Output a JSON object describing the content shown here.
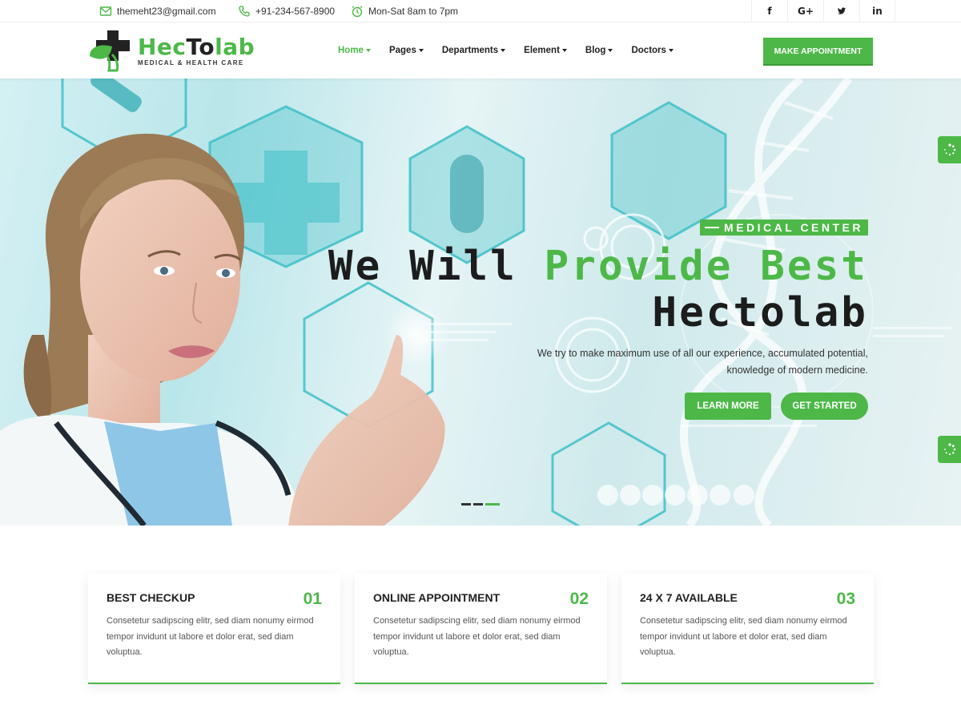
{
  "topbar": {
    "email": "themeht23@gmail.com",
    "phone": "+91-234-567-8900",
    "hours": "Mon-Sat 8am to 7pm",
    "social": [
      {
        "label": "f",
        "icon": "facebook-icon"
      },
      {
        "label": "G+",
        "icon": "google-plus-icon"
      },
      {
        "label": "𝕥",
        "icon": "twitter-icon"
      },
      {
        "label": "in",
        "icon": "linkedin-icon"
      }
    ]
  },
  "brand": {
    "name_green": "Hec",
    "name_dark": "To",
    "name_end": "lab",
    "tagline": "MEDICAL & HEALTH CARE"
  },
  "nav": {
    "items": [
      "Home",
      "Pages",
      "Departments",
      "Element",
      "Blog",
      "Doctors"
    ],
    "active": "Home",
    "cta": "MAKE APPOINTMENT"
  },
  "hero": {
    "tagline": "MEDICAL CENTER",
    "title_plain": "We Will ",
    "title_green": "Provide Best",
    "title_line2": "Hectolab",
    "description": "We try to make maximum use of all our experience, accumulated potential, knowledge of modern medicine.",
    "btn_learn": "LEARN MORE",
    "btn_start": "GET STARTED",
    "slides": 3,
    "active_slide": 3
  },
  "features": [
    {
      "title": "BEST CHECKUP",
      "num": "01",
      "text": "Consetetur sadipscing elitr, sed diam nonumy eirmod tempor invidunt ut labore et dolor erat, sed diam voluptua."
    },
    {
      "title": "ONLINE APPOINTMENT",
      "num": "02",
      "text": "Consetetur sadipscing elitr, sed diam nonumy eirmod tempor invidunt ut labore et dolor erat, sed diam voluptua."
    },
    {
      "title": "24 X 7 AVAILABLE",
      "num": "03",
      "text": "Consetetur sadipscing elitr, sed diam nonumy eirmod tempor invidunt ut labore et dolor erat, sed diam voluptua."
    }
  ],
  "colors": {
    "accent": "#4db848",
    "dark": "#1c1c1c"
  }
}
